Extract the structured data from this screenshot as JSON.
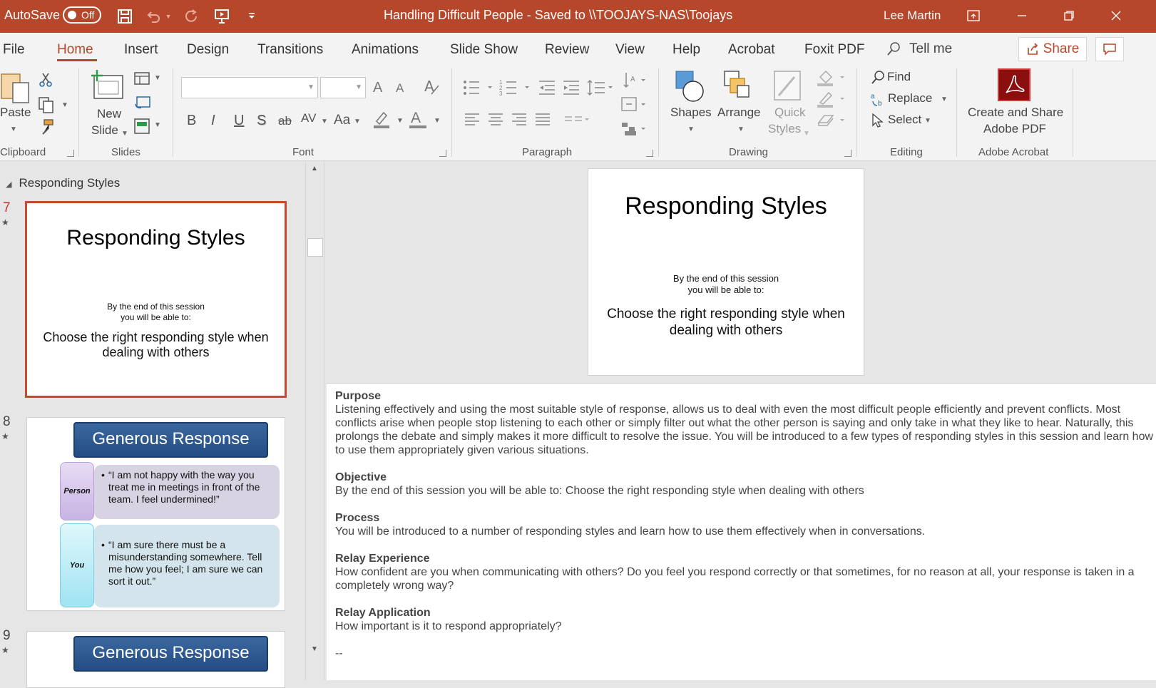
{
  "titlebar": {
    "autosave_label": "AutoSave",
    "toggle_text": "Off",
    "doc_title": "Handling Difficult People  -  Saved to \\\\TOOJAYS-NAS\\Toojays",
    "user_name": "Lee Martin"
  },
  "tabs": [
    "File",
    "Home",
    "Insert",
    "Design",
    "Transitions",
    "Animations",
    "Slide Show",
    "Review",
    "View",
    "Help",
    "Acrobat",
    "Foxit PDF"
  ],
  "tell_me": "Tell me",
  "share_label": "Share",
  "ribbon": {
    "clipboard": {
      "paste": "Paste",
      "label": "Clipboard"
    },
    "slides": {
      "new_slide_line1": "New",
      "new_slide_line2": "Slide",
      "label": "Slides"
    },
    "font": {
      "label": "Font",
      "bold": "B",
      "italic": "I",
      "underline": "U",
      "shadow": "S",
      "strike": "ab",
      "spacing": "AV",
      "case": "Aa",
      "grow": "A",
      "shrink": "A",
      "color": "A"
    },
    "paragraph": {
      "label": "Paragraph"
    },
    "drawing": {
      "shapes": "Shapes",
      "arrange": "Arrange",
      "quick1": "Quick",
      "quick2": "Styles",
      "label": "Drawing"
    },
    "editing": {
      "find": "Find",
      "replace": "Replace",
      "select": "Select",
      "label": "Editing"
    },
    "acrobat": {
      "create1": "Create and Share",
      "create2": "Adobe PDF",
      "label": "Adobe Acrobat"
    }
  },
  "thumbnails": {
    "section": "Responding Styles",
    "slides": [
      {
        "num": "7",
        "title": "Responding Styles",
        "sub1": "By the end of this session",
        "sub2": "you will be able to:",
        "main1": "Choose the right responding style when",
        "main2": "dealing with others"
      },
      {
        "num": "8",
        "banner": "Generous Response",
        "person_label": "Person",
        "person_text": "“I am not happy with the way you treat me in meetings in front of the team. I feel undermined!”",
        "you_label": "You",
        "you_text": "“I am sure there must be a misunderstanding somewhere. Tell me how you feel; I am sure we can sort it out.”"
      },
      {
        "num": "9",
        "banner": "Generous Response"
      }
    ]
  },
  "main_slide": {
    "title": "Responding Styles",
    "sub1": "By the end of this session",
    "sub2": "you will be able to:",
    "main1": "Choose the right responding style when",
    "main2": "dealing with others"
  },
  "notes": {
    "purpose_h": "Purpose",
    "purpose": "Listening effectively and using the most suitable style of response, allows us to deal with even the most difficult people efficiently and prevent conflicts. Most conflicts arise when people stop listening to each other or simply filter out what the other person is saying and only take in what they like to hear. Naturally, this prolongs the debate and simply makes it more difficult to resolve the issue.  You will be introduced to a few types of responding styles in this session and learn how to use them appropriately given various situations.",
    "objective_h": "Objective",
    "objective": "By the end of this session you will be able to: Choose the right responding style when dealing with others",
    "process_h": "Process",
    "process": "You will be introduced to a number of responding styles and learn how to use them effectively when in conversations.",
    "relay_exp_h": "Relay Experience",
    "relay_exp": "How confident are you when communicating with others? Do you feel you respond correctly or that sometimes, for no reason at all, your response is taken in a completely wrong way?",
    "relay_app_h": "Relay Application",
    "relay_app": "How important is it to respond appropriately?",
    "trailing": "--"
  }
}
